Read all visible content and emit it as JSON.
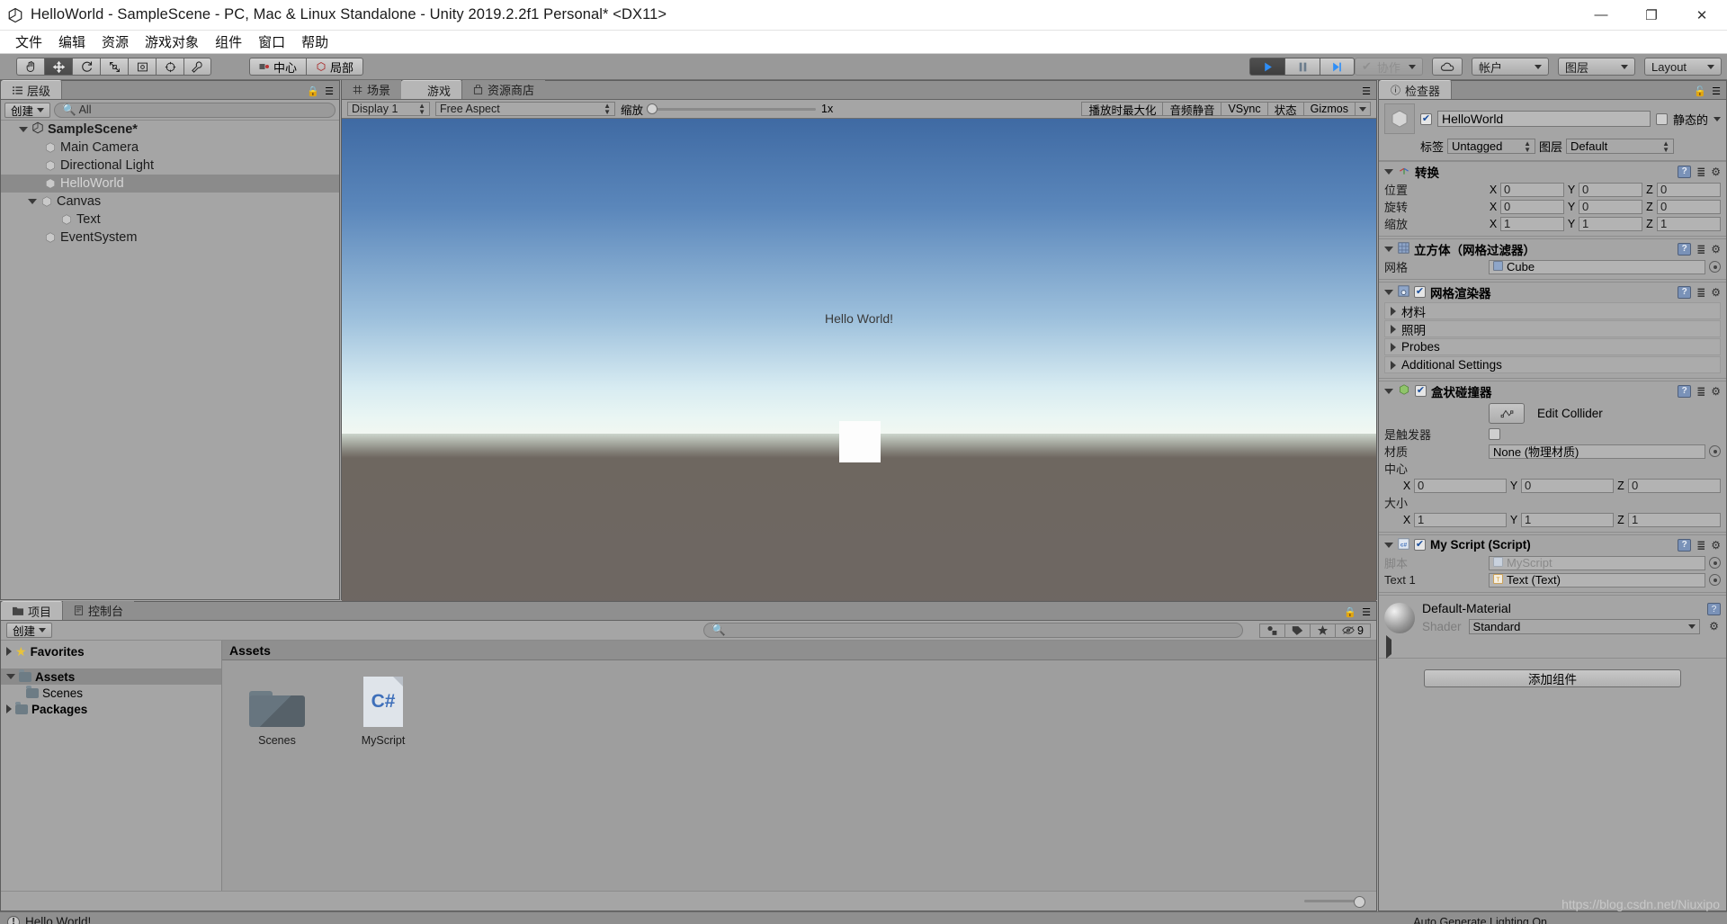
{
  "window": {
    "title": "HelloWorld - SampleScene - PC, Mac & Linux Standalone - Unity 2019.2.2f1 Personal* <DX11>",
    "minimize": "—",
    "maximize": "❐",
    "close": "✕"
  },
  "menu": {
    "items": [
      "文件",
      "编辑",
      "资源",
      "游戏对象",
      "组件",
      "窗口",
      "帮助"
    ]
  },
  "toolbar": {
    "tools": [
      {
        "name": "hand-tool",
        "selected": false
      },
      {
        "name": "move-tool",
        "selected": true
      },
      {
        "name": "rotate-tool",
        "selected": false
      },
      {
        "name": "scale-tool",
        "selected": false
      },
      {
        "name": "rect-tool",
        "selected": false
      },
      {
        "name": "transform-tool",
        "selected": false
      },
      {
        "name": "custom-tool",
        "selected": false
      }
    ],
    "pivot_label": "中心",
    "space_label": "局部",
    "play_label": "▶",
    "pause_label": "❙❙",
    "step_label": "▶❘",
    "collab_label": "协作",
    "cloud_label": "cloud-icon",
    "account_label": "帐户",
    "layers_label": "图层",
    "layout_label": "Layout"
  },
  "hierarchy": {
    "tab_label": "层级",
    "create_label": "创建",
    "search_placeholder": "All",
    "items": [
      {
        "label": "SampleScene*",
        "depth": 0,
        "type": "scene",
        "expanded": true,
        "selected": false
      },
      {
        "label": "Main Camera",
        "depth": 1,
        "type": "object",
        "expanded": null,
        "selected": false
      },
      {
        "label": "Directional Light",
        "depth": 1,
        "type": "object",
        "expanded": null,
        "selected": false
      },
      {
        "label": "HelloWorld",
        "depth": 1,
        "type": "object",
        "expanded": null,
        "selected": true
      },
      {
        "label": "Canvas",
        "depth": 1,
        "type": "object",
        "expanded": true,
        "selected": false
      },
      {
        "label": "Text",
        "depth": 2,
        "type": "object",
        "expanded": null,
        "selected": false
      },
      {
        "label": "EventSystem",
        "depth": 1,
        "type": "object",
        "expanded": null,
        "selected": false
      }
    ]
  },
  "gameview": {
    "tabs": [
      {
        "label": "场景",
        "icon": "grid-icon",
        "active": false
      },
      {
        "label": "游戏",
        "icon": "gamepad-icon",
        "active": true
      },
      {
        "label": "资源商店",
        "icon": "store-icon",
        "active": false
      }
    ],
    "display": "Display 1",
    "aspect": "Free Aspect",
    "scale_label": "缩放",
    "scale_value": "1x",
    "toggles": [
      "播放时最大化",
      "音频静音",
      "VSync",
      "状态",
      "Gizmos"
    ],
    "scene_text": "Hello World!"
  },
  "inspector": {
    "tab_label": "检查器",
    "object_name": "HelloWorld",
    "enabled": true,
    "static_label": "静态的",
    "tag_label": "标签",
    "tag_value": "Untagged",
    "layer_label": "图层",
    "layer_value": "Default",
    "components": [
      {
        "name": "转换",
        "icon": "transform-icon",
        "rows": [
          {
            "label": "位置",
            "x": "0",
            "y": "0",
            "z": "0"
          },
          {
            "label": "旋转",
            "x": "0",
            "y": "0",
            "z": "0"
          },
          {
            "label": "缩放",
            "x": "1",
            "y": "1",
            "z": "1"
          }
        ]
      }
    ],
    "meshfilter": {
      "title": "立方体（网格过滤器）",
      "mesh_label": "网格",
      "mesh_value": "Cube"
    },
    "meshrenderer": {
      "title": "网格渲染器",
      "enabled": true,
      "sections": [
        "材料",
        "照明",
        "Probes",
        "Additional Settings"
      ]
    },
    "boxcollider": {
      "title": "盒状碰撞器",
      "enabled": true,
      "edit_collider_label": "Edit Collider",
      "is_trigger_label": "是触发器",
      "is_trigger_value": false,
      "material_label": "材质",
      "material_value": "None (物理材质)",
      "center_label": "中心",
      "center": {
        "x": "0",
        "y": "0",
        "z": "0"
      },
      "size_label": "大小",
      "size": {
        "x": "1",
        "y": "1",
        "z": "1"
      }
    },
    "script": {
      "title": "My Script (Script)",
      "enabled": true,
      "script_label": "脚本",
      "script_value": "MyScript",
      "field_label": "Text 1",
      "field_value": "Text (Text)"
    },
    "material": {
      "name": "Default-Material",
      "shader_label": "Shader",
      "shader_value": "Standard"
    },
    "add_component_label": "添加组件"
  },
  "project": {
    "tabs": [
      {
        "label": "项目",
        "icon": "folder-icon",
        "active": true
      },
      {
        "label": "控制台",
        "icon": "console-icon",
        "active": false
      }
    ],
    "create_label": "创建",
    "search_placeholder": "",
    "hidden_count": "9",
    "tree": [
      {
        "label": "Favorites",
        "depth": 0,
        "bold": true,
        "icon": "star",
        "expanded": false,
        "selected": false
      },
      {
        "label": "Assets",
        "depth": 0,
        "bold": true,
        "icon": "folder",
        "expanded": true,
        "selected": true
      },
      {
        "label": "Scenes",
        "depth": 1,
        "bold": false,
        "icon": "folder",
        "expanded": null,
        "selected": false
      },
      {
        "label": "Packages",
        "depth": 0,
        "bold": true,
        "icon": "folder",
        "expanded": false,
        "selected": false
      }
    ],
    "breadcrumb": "Assets",
    "assets": [
      {
        "label": "Scenes",
        "type": "folder"
      },
      {
        "label": "MyScript",
        "type": "csharp"
      }
    ]
  },
  "status": {
    "message": "Hello World!",
    "lighting": "Auto Generate Lighting On",
    "watermark": "https://blog.csdn.net/Niuxipo"
  }
}
